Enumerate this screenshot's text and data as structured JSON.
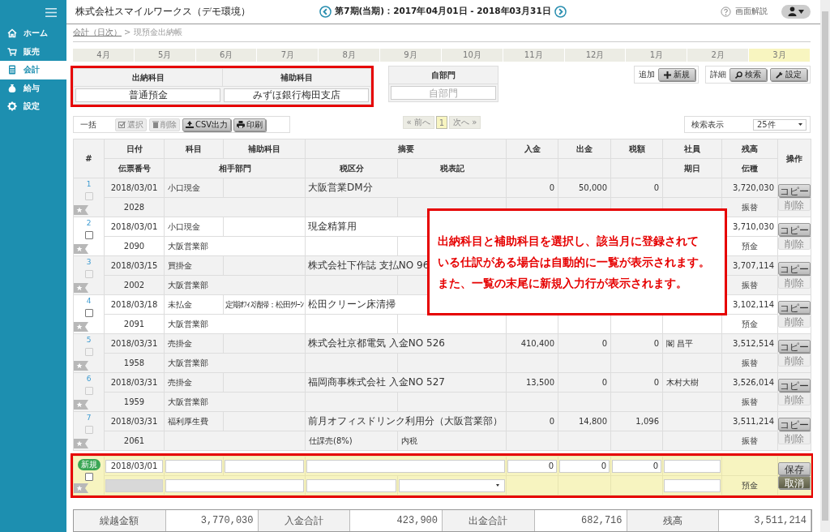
{
  "sidebar": {
    "items": [
      {
        "label": "ホーム",
        "selected": false
      },
      {
        "label": "販売",
        "selected": false
      },
      {
        "label": "会計",
        "selected": true
      },
      {
        "label": "給与",
        "selected": false
      },
      {
        "label": "設定",
        "selected": false
      }
    ]
  },
  "header": {
    "company": "株式会社スマイルワークス（デモ環境）",
    "period": "第7期(当期)：2017年04月01日 - 2018年03月31日",
    "help": "画面解説"
  },
  "breadcrumb": [
    {
      "label": "会計（日次）",
      "kind": "link"
    },
    {
      "label": "> 現預金出納帳",
      "kind": "text"
    }
  ],
  "months": [
    {
      "label": "4月",
      "selected": false
    },
    {
      "label": "5月",
      "selected": false
    },
    {
      "label": "6月",
      "selected": false
    },
    {
      "label": "7月",
      "selected": false
    },
    {
      "label": "8月",
      "selected": false
    },
    {
      "label": "9月",
      "selected": false
    },
    {
      "label": "10月",
      "selected": false
    },
    {
      "label": "11月",
      "selected": false
    },
    {
      "label": "12月",
      "selected": false
    },
    {
      "label": "1月",
      "selected": false
    },
    {
      "label": "2月",
      "selected": false
    },
    {
      "label": "3月",
      "selected": true
    }
  ],
  "filters": {
    "fields": [
      {
        "label": "出納科目",
        "value": "普通預金"
      },
      {
        "label": "補助科目",
        "value": "みずほ銀行梅田支店"
      }
    ],
    "department": {
      "label": "自部門",
      "placeholder": "自部門"
    }
  },
  "button_groups": [
    {
      "label": "追加",
      "buttons": [
        {
          "label": "新規",
          "kind": "add"
        }
      ]
    },
    {
      "label": "詳細",
      "buttons": [
        {
          "label": "検索",
          "kind": "search"
        },
        {
          "label": "設定",
          "kind": "settings"
        }
      ]
    }
  ],
  "bulk": {
    "label": "一括",
    "buttons": [
      {
        "label": "選択",
        "kind": "select",
        "disabled": true
      },
      {
        "label": "削除",
        "kind": "delete",
        "disabled": true
      },
      {
        "label": "CSV出力",
        "kind": "csv",
        "disabled": false
      },
      {
        "label": "印刷",
        "kind": "print",
        "disabled": false
      }
    ]
  },
  "pagination": {
    "prev": "« 前へ",
    "pages": [
      {
        "label": "1",
        "selected": true
      }
    ],
    "next": "次へ »"
  },
  "page_size": {
    "label": "検索表示",
    "value": "25件"
  },
  "table": {
    "header_top": [
      "#",
      "日付",
      "科目",
      "補助科目",
      "摘要",
      "入金",
      "出金",
      "税額",
      "社員",
      "残高",
      "操作"
    ],
    "header_bottom": [
      "伝票番号",
      "相手部門",
      "税区分",
      "税表記",
      "期日",
      "伝種"
    ],
    "entries": [
      {
        "no": "1",
        "checked": false,
        "disabled": true,
        "date": "2018/03/01",
        "account": "小口現金",
        "memo": "大阪営業DM分",
        "deposit": "0",
        "withdrawal": "50,000",
        "tax": "0",
        "balance": "3,720,030",
        "slip": "2028",
        "type": "振替",
        "actions": [
          {
            "label": "コピー",
            "disabled": false
          },
          {
            "label": "削除",
            "disabled": true
          }
        ]
      },
      {
        "no": "2",
        "checked": false,
        "disabled": false,
        "date": "2018/03/01",
        "account": "小口現金",
        "memo": "現金精算用",
        "balance": "3,710,030",
        "slip": "2090",
        "dept": "大阪営業部",
        "type": "預金",
        "actions": [
          {
            "label": "コピー",
            "disabled": false
          },
          {
            "label": "削除",
            "disabled": true
          }
        ]
      },
      {
        "no": "3",
        "checked": false,
        "disabled": true,
        "date": "2018/03/15",
        "account": "買掛金",
        "memo": "株式会社下作誌 支払NO 96",
        "balance": "3,707,114",
        "slip": "2002",
        "dept": "大阪営業部",
        "type": "振替",
        "actions": [
          {
            "label": "コピー",
            "disabled": false
          },
          {
            "label": "削除",
            "disabled": true
          }
        ]
      },
      {
        "no": "4",
        "checked": false,
        "disabled": false,
        "date": "2018/03/18",
        "account": "未払金",
        "sub": "定期ｵﾌｨｽ清掃：松田ｸﾘｰﾝ",
        "memo": "松田クリーン床清掃",
        "balance": "3,102,114",
        "slip": "2091",
        "dept": "大阪営業部",
        "type": "預金",
        "actions": [
          {
            "label": "コピー",
            "disabled": false
          },
          {
            "label": "削除",
            "disabled": true
          }
        ]
      },
      {
        "no": "5",
        "checked": false,
        "disabled": true,
        "date": "2018/03/31",
        "account": "売掛金",
        "memo": "株式会社京都電気 入金NO 526",
        "deposit": "410,400",
        "withdrawal": "0",
        "tax": "0",
        "staff": "閣 昌平",
        "balance": "3,512,514",
        "slip": "1958",
        "dept": "大阪営業部",
        "type": "振替",
        "actions": [
          {
            "label": "コピー",
            "disabled": false
          },
          {
            "label": "削除",
            "disabled": true
          }
        ]
      },
      {
        "no": "6",
        "checked": false,
        "disabled": true,
        "date": "2018/03/31",
        "account": "売掛金",
        "memo": "福岡商事株式会社 入金NO 527",
        "deposit": "13,500",
        "withdrawal": "0",
        "tax": "0",
        "staff": "木村大樹",
        "balance": "3,526,014",
        "slip": "1959",
        "dept": "大阪営業部",
        "type": "振替",
        "actions": [
          {
            "label": "コピー",
            "disabled": false
          },
          {
            "label": "削除",
            "disabled": true
          }
        ]
      },
      {
        "no": "7",
        "checked": false,
        "disabled": true,
        "date": "2018/03/31",
        "account": "福利厚生費",
        "memo": "前月オフィスドリンク利用分（大阪営業部）",
        "deposit": "0",
        "withdrawal": "14,800",
        "tax": "1,096",
        "balance": "3,511,214",
        "slip": "2061",
        "tax_class": "仕課売(8%)",
        "tax_note": "内税",
        "type": "振替",
        "actions": [
          {
            "label": "コピー",
            "disabled": false
          },
          {
            "label": "削除",
            "disabled": true
          }
        ]
      }
    ],
    "new_entry": {
      "badge": "新規",
      "checked": false,
      "date": "2018/03/01",
      "deposit": "0",
      "withdrawal": "0",
      "tax": "0",
      "type": "預金",
      "actions": [
        {
          "label": "保存",
          "kind": "save"
        },
        {
          "label": "取消",
          "kind": "cancel"
        }
      ]
    }
  },
  "callout": {
    "lines": [
      "出納科目と補助科目を選択し、該当月に登録されて",
      "いる仕訳がある場合は自動的に一覧が表示されます。",
      "また、一覧の末尾に新規入力行が表示されます。"
    ]
  },
  "totals": [
    {
      "label": "繰越金額",
      "value": "3,770,030"
    },
    {
      "label": "入金合計",
      "value": "423,900"
    },
    {
      "label": "出金合計",
      "value": "682,716"
    },
    {
      "label": "残高",
      "value": "3,511,214"
    }
  ]
}
